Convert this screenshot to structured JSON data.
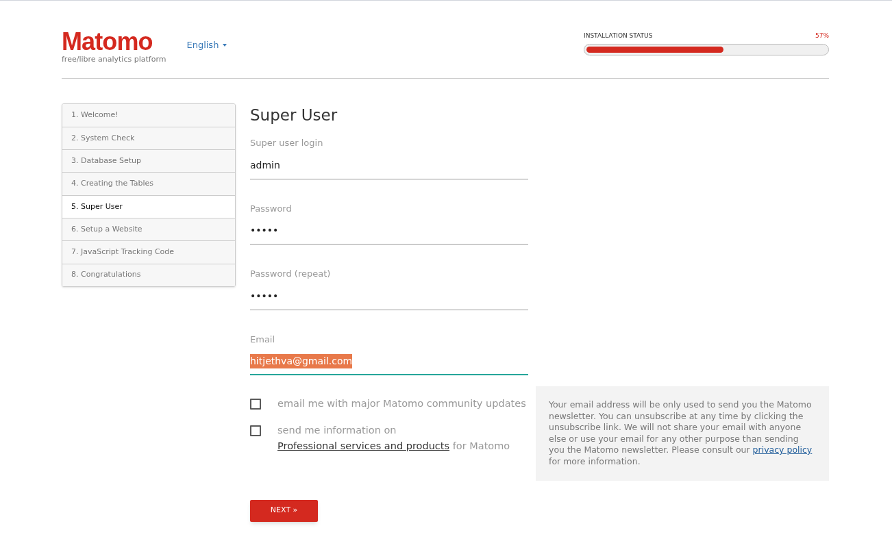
{
  "header": {
    "logo": "Matomo",
    "tagline": "free/libre analytics platform",
    "language": "English",
    "status_label": "INSTALLATION STATUS",
    "status_percent": "57%",
    "level": 0.57
  },
  "steps": [
    {
      "label": "1. Welcome!",
      "selected": false
    },
    {
      "label": "2. System Check",
      "selected": false
    },
    {
      "label": "3. Database Setup",
      "selected": false
    },
    {
      "label": "4. Creating the Tables",
      "selected": false
    },
    {
      "label": "5. Super User",
      "selected": true
    },
    {
      "label": "6. Setup a Website",
      "selected": false
    },
    {
      "label": "7. JavaScript Tracking Code",
      "selected": false
    },
    {
      "label": "8. Congratulations",
      "selected": false
    }
  ],
  "form": {
    "title": "Super User",
    "fields": [
      {
        "label": "Super user login",
        "value": "admin",
        "focused": false
      },
      {
        "label": "Password",
        "value": "•••••",
        "focused": false
      },
      {
        "label": "Password (repeat)",
        "value": "•••••",
        "focused": false
      },
      {
        "label": "Email",
        "value": "hitjethva@gmail.com",
        "focused": true
      }
    ],
    "checkboxes": [
      {
        "text_before": "email me with major Matomo community updates",
        "checked": false
      },
      {
        "text_before": "send me information on",
        "link": "Professional services and products",
        "text_after": "for Matomo",
        "checked": false
      }
    ],
    "note": {
      "text": "Your email address will be only used to send you the Matomo newsletter. You can unsubscribe at any time by clicking the unsubscribe link. We will not share your email with anyone else or use your email for any other purpose than sending you the Matomo newsletter. Please consult our",
      "link": "privacy policy",
      "text_after": "for more information."
    },
    "button": "NEXT »"
  }
}
